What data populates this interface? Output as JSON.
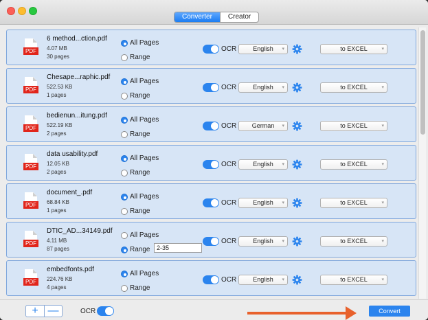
{
  "tabs": [
    {
      "label": "Converter",
      "active": true
    },
    {
      "label": "Creator",
      "active": false
    }
  ],
  "files": [
    {
      "name": "6 method...ction.pdf",
      "size": "4.07 MB",
      "pages": "30 pages",
      "page_mode": "all",
      "range_value": "",
      "ocr": true,
      "language": "English",
      "format": "to EXCEL"
    },
    {
      "name": "Chesape...raphic.pdf",
      "size": "522.53 KB",
      "pages": "1 pages",
      "page_mode": "all",
      "range_value": "",
      "ocr": true,
      "language": "English",
      "format": "to EXCEL"
    },
    {
      "name": "bedienun...itung.pdf",
      "size": "522.19 KB",
      "pages": "2 pages",
      "page_mode": "all",
      "range_value": "",
      "ocr": true,
      "language": "German",
      "format": "to EXCEL"
    },
    {
      "name": "data usability.pdf",
      "size": "12.05 KB",
      "pages": "2 pages",
      "page_mode": "all",
      "range_value": "",
      "ocr": true,
      "language": "English",
      "format": "to EXCEL"
    },
    {
      "name": "document_.pdf",
      "size": "68.84 KB",
      "pages": "1 pages",
      "page_mode": "all",
      "range_value": "",
      "ocr": true,
      "language": "English",
      "format": "to EXCEL"
    },
    {
      "name": "DTIC_AD...34149.pdf",
      "size": "4.11 MB",
      "pages": "87 pages",
      "page_mode": "range",
      "range_value": "2-35",
      "ocr": true,
      "language": "English",
      "format": "to EXCEL"
    },
    {
      "name": "embedfonts.pdf",
      "size": "224.76 KB",
      "pages": "4 pages",
      "page_mode": "all",
      "range_value": "",
      "ocr": true,
      "language": "English",
      "format": "to EXCEL"
    }
  ],
  "labels": {
    "pdf_badge": "PDF",
    "all_pages": "All Pages",
    "range": "Range",
    "ocr": "OCR"
  },
  "icons": {
    "gear": "gear-icon",
    "add": "plus-icon",
    "remove": "minus-icon",
    "arrow": "arrow-right-icon"
  },
  "bottom": {
    "add_label": "+",
    "remove_label": "—",
    "ocr_label": "OCR",
    "ocr_on": true,
    "convert_label": "Convert"
  },
  "colors": {
    "accent": "#2b84ee",
    "row_bg": "#d7e5f6",
    "row_border": "#7ea6dc",
    "pdf_red": "#e1251b",
    "arrow_orange": "#e8612c"
  }
}
